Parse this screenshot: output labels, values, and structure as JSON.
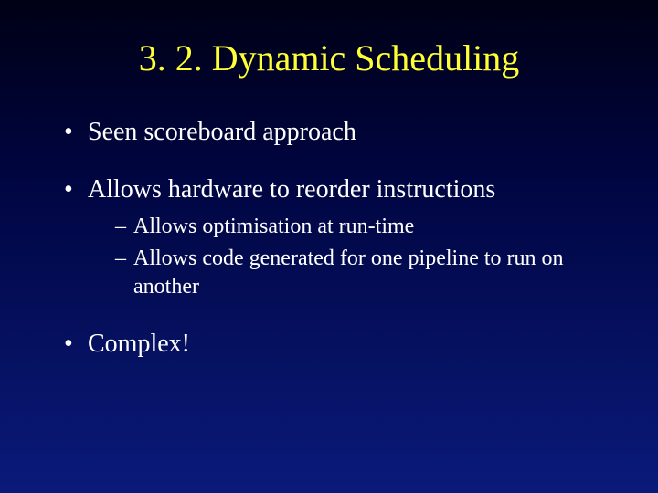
{
  "title": "3. 2. Dynamic Scheduling",
  "bullets": [
    {
      "text": "Seen scoreboard approach",
      "sub": []
    },
    {
      "text": "Allows hardware to reorder instructions",
      "sub": [
        "Allows optimisation at run-time",
        "Allows code generated for one pipeline to run on another"
      ]
    },
    {
      "text": "Complex!",
      "sub": []
    }
  ]
}
